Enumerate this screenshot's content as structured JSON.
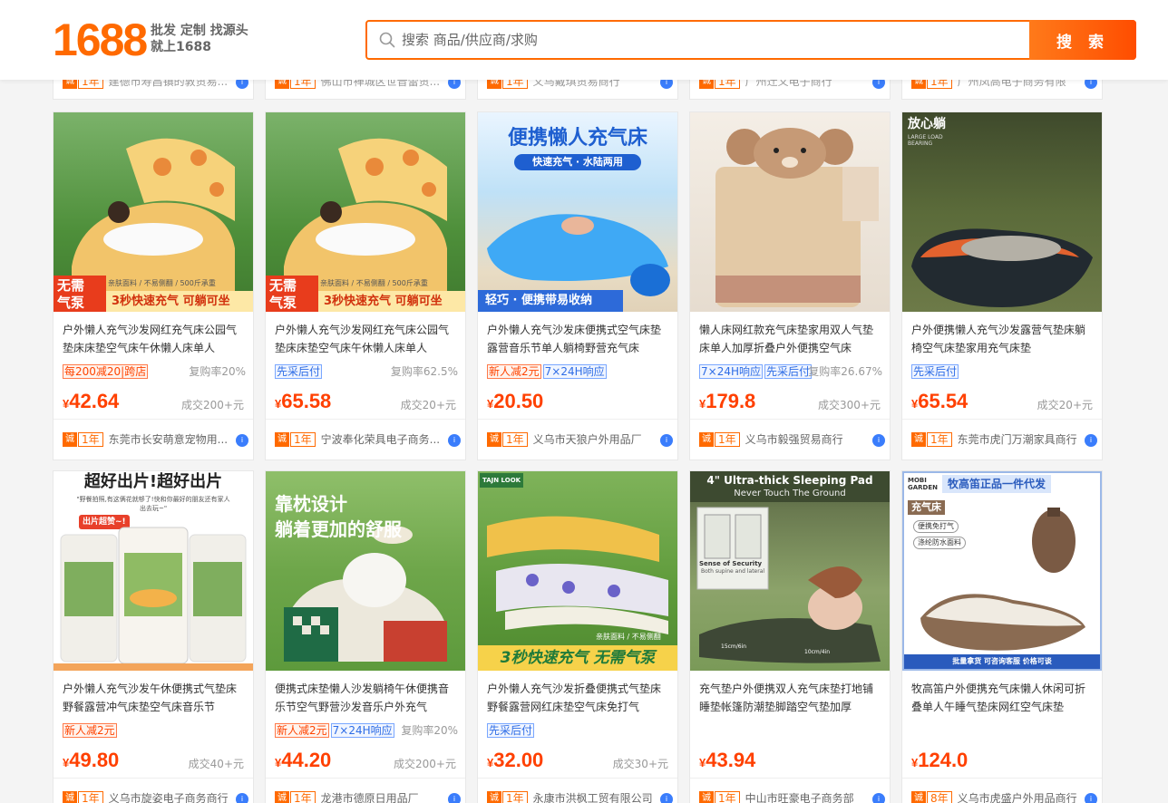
{
  "logo": {
    "number": "1688",
    "tagline1": "批发 定制 找源头",
    "tagline2": "就上1688"
  },
  "search": {
    "placeholder": "搜索 商品/供应商/求购",
    "button": "搜 索",
    "icon": "search-icon"
  },
  "colors": {
    "brand": "#ff6a00",
    "price": "#ff4000",
    "tag_red": "#ff4400",
    "tag_blue": "#2e6de6"
  },
  "top_row_shops": [
    {
      "year": "1年",
      "name": "建德市寿昌镇的敦贸易..."
    },
    {
      "year": "1年",
      "name": "佛山市禅城区世音蕾贸..."
    },
    {
      "year": "1年",
      "name": "义乌戴琪贸易商行"
    },
    {
      "year": "1年",
      "name": "广州迁义电子商行"
    },
    {
      "year": "1年",
      "name": "广州凤高电子商务有限"
    }
  ],
  "products": [
    {
      "title": "户外懒人充气沙发网红充气床公园气垫床床垫空气床午休懒人床单人",
      "tags": [
        {
          "text": "每200减20|跨店",
          "color": "red"
        }
      ],
      "rate": "复购率20%",
      "price": "42.64",
      "sold": "成交200+元",
      "shop": {
        "year": "1年",
        "name": "东莞市长安萌意宠物用..."
      },
      "image": {
        "title": "无需",
        "title2": "气泵",
        "sub": "亲肤面料 / 不易侧翻 / 500斤承重",
        "banner": "3秒快速充气  可躺可坐"
      }
    },
    {
      "title": "户外懒人充气沙发网红充气床公园气垫床床垫空气床午休懒人床单人",
      "tags": [
        {
          "text": "先采后付",
          "color": "blue"
        }
      ],
      "rate": "复购率62.5%",
      "price": "65.58",
      "sold": "成交20+元",
      "shop": {
        "year": "1年",
        "name": "宁波奉化荣具电子商务..."
      },
      "image": {
        "title": "无需",
        "title2": "气泵",
        "sub": "亲肤面料 / 不易侧翻 / 500斤承重",
        "banner": "3秒快速充气  可躺可坐"
      }
    },
    {
      "title": "户外懒人充气沙发床便携式空气床垫露营音乐节单人躺椅野营充气床",
      "tags": [
        {
          "text": "新人减2元",
          "color": "red"
        },
        {
          "text": "7×24H响应",
          "color": "blue"
        }
      ],
      "rate": "",
      "price": "20.50",
      "sold": "",
      "shop": {
        "year": "1年",
        "name": "义乌市天狼户外用品厂"
      },
      "image": {
        "title": "便携懒人充气床",
        "sub": "快速充气 · 水陆两用",
        "banner": "轻巧 · 便携带易收纳"
      }
    },
    {
      "title": "懒人床网红款充气床垫家用双人气垫床单人加厚折叠户外便携空气床",
      "tags": [
        {
          "text": "7×24H响应",
          "color": "blue"
        },
        {
          "text": "先采后付",
          "color": "blue"
        }
      ],
      "rate": "复购率26.67%",
      "price": "179.8",
      "sold": "成交300+元",
      "shop": {
        "year": "1年",
        "name": "义乌市毅强贸易商行"
      },
      "image": {}
    },
    {
      "title": "户外便携懒人充气沙发露营气垫床躺椅空气床垫家用充气床垫",
      "tags": [
        {
          "text": "先采后付",
          "color": "blue"
        }
      ],
      "rate": "",
      "price": "65.54",
      "sold": "成交20+元",
      "shop": {
        "year": "1年",
        "name": "东莞市虎门万潮家具商行"
      },
      "image": {
        "title": "放心躺",
        "sub": "LARGE LOAD BEARING"
      }
    },
    {
      "title": "户外懒人充气沙发午休便携式气垫床野餐露营冲气床垫空气床音乐节",
      "tags": [
        {
          "text": "新人减2元",
          "color": "red"
        }
      ],
      "rate": "",
      "price": "49.80",
      "sold": "成交40+元",
      "shop": {
        "year": "1年",
        "name": "义乌市旋姿电子商务商行"
      },
      "image": {
        "title": "超好出片!超好出片",
        "sub": "\"野餐拍照,有这俩花就够了!快和你最好的朋友还有家人出去玩~\"",
        "banner": "出片超赞~!"
      }
    },
    {
      "title": "便携式床垫懒人沙发躺椅午休便携音乐节空气野营沙发音乐户外充气",
      "tags": [
        {
          "text": "新人减2元",
          "color": "red"
        },
        {
          "text": "7×24H响应",
          "color": "blue"
        }
      ],
      "rate": "复购率20%",
      "price": "44.20",
      "sold": "成交200+元",
      "shop": {
        "year": "1年",
        "name": "龙港市德原日用品厂"
      },
      "image": {
        "title": "靠枕设计",
        "sub": "躺着更加的舒服"
      }
    },
    {
      "title": "户外懒人充气沙发折叠便携式气垫床野餐露营网红床垫空气床免打气",
      "tags": [
        {
          "text": "先采后付",
          "color": "blue"
        }
      ],
      "rate": "",
      "price": "32.00",
      "sold": "成交30+元",
      "shop": {
        "year": "1年",
        "name": "永康市洪枫工贸有限公司"
      },
      "image": {
        "title": "TAJN LOOK",
        "sub": "亲肤面料 / 不易侧翻",
        "banner": "3秒快速充气 无需气泵"
      }
    },
    {
      "title": "充气垫户外便携双人充气床垫打地铺睡垫帐篷防潮垫脚踏空气垫加厚",
      "tags": [],
      "rate": "",
      "price": "43.94",
      "sold": "",
      "shop": {
        "year": "1年",
        "name": "中山市旺豪电子商务部"
      },
      "image": {
        "title": "4\" Ultra-thick Sleeping Pad",
        "sub": "Never Touch The Ground",
        "label1": "Sense of Security",
        "label2": "Both supine and lateral",
        "dim1": "15cm/6in",
        "dim2": "10cm/4in"
      }
    },
    {
      "title": "牧高笛户外便携充气床懒人休闲可折叠单人午睡气垫床网红空气床垫",
      "tags": [],
      "rate": "",
      "price": "124.0",
      "sold": "",
      "shop": {
        "year": "8年",
        "name": "义乌市虎盛户外用品商行"
      },
      "image": {
        "title": "MOBI GARDEN",
        "sub": "牧高笛正品一件代发",
        "badge": "充气床",
        "feat1": "便携免打气",
        "feat2": "涤纶防水面料",
        "footer": "批量拿货   可咨询客服   价格可谈"
      }
    }
  ]
}
